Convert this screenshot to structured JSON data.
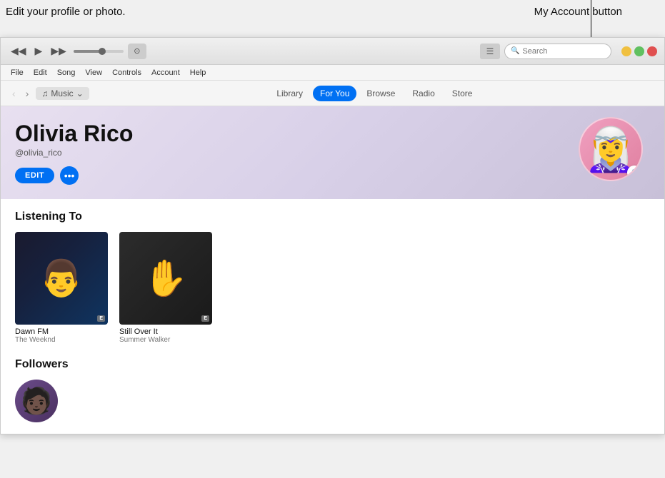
{
  "annotations": {
    "left_text": "Edit your profile or photo.",
    "right_text": "My Account button"
  },
  "titlebar": {
    "transport": {
      "back": "◀◀",
      "play": "▶",
      "forward": "▶▶"
    },
    "apple_logo": "",
    "search_placeholder": "Search",
    "search_label": "Search"
  },
  "menubar": {
    "items": [
      "File",
      "Edit",
      "Song",
      "View",
      "Controls",
      "Account",
      "Help"
    ]
  },
  "navbar": {
    "music_label": "Music",
    "tabs": [
      "Library",
      "For You",
      "Browse",
      "Radio",
      "Store"
    ],
    "active_tab": "For You"
  },
  "profile": {
    "name": "Olivia Rico",
    "handle": "@olivia_rico",
    "edit_label": "EDIT",
    "more_label": "•••",
    "avatar_emoji": "🧝‍♀️",
    "lock_icon": "🔒"
  },
  "listening_to": {
    "section_title": "Listening To",
    "albums": [
      {
        "title": "Dawn FM",
        "artist": "The Weeknd",
        "explicit": "E",
        "emoji": "👨"
      },
      {
        "title": "Still Over It",
        "artist": "Summer Walker",
        "explicit": "E",
        "emoji": "✋"
      }
    ]
  },
  "followers": {
    "section_title": "Followers",
    "items": [
      {
        "emoji": "🧑🏿"
      }
    ]
  },
  "window_controls": {
    "minimize": "—",
    "maximize": "□",
    "close": "✕"
  }
}
